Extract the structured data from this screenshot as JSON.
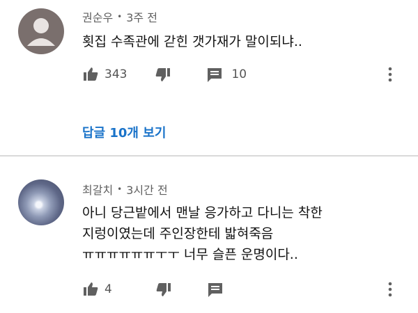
{
  "comments": [
    {
      "author": "권순우",
      "separator": "•",
      "time": "3주 전",
      "lines": [
        "횟집 수족관에 갇힌 갯가재가 말이되냐.."
      ],
      "likes": "343",
      "replies": "10",
      "view_replies": "답글 10개 보기",
      "avatar_icon": "default-avatar-icon"
    },
    {
      "author": "최갈치",
      "separator": "•",
      "time": "3시간 전",
      "lines": [
        "아니 당근밭에서 맨날 응가하고 다니는 착한",
        "지렁이였는데 주인장한테 밟혀죽음",
        "ㅠㅠㅠㅠㅠㅠㅜㅜ 너무 슬픈 운명이다.."
      ],
      "likes": "4",
      "avatar_icon": "photo-avatar"
    }
  ],
  "colors": {
    "link": "#1a73c9",
    "meta": "#606060",
    "icon": "#606060"
  }
}
